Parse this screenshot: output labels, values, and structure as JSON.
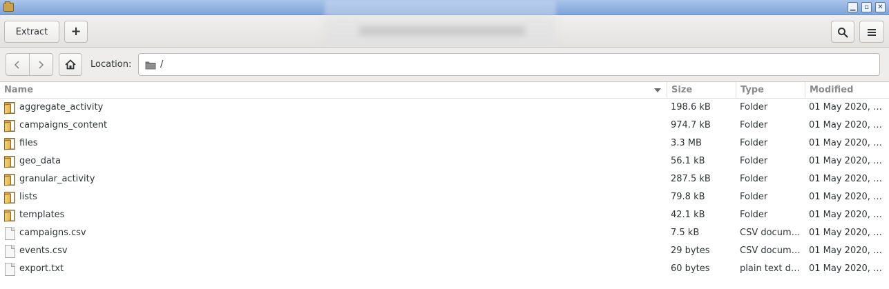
{
  "toolbar": {
    "extract_label": "Extract",
    "add_label": "+"
  },
  "location": {
    "label": "Location:",
    "path": "/"
  },
  "columns": {
    "name": "Name",
    "size": "Size",
    "type": "Type",
    "modified": "Modified"
  },
  "files": [
    {
      "icon": "folder-icon",
      "name": "aggregate_activity",
      "size": "198.6 kB",
      "type": "Folder",
      "modified": "01 May 2020, …"
    },
    {
      "icon": "folder-icon",
      "name": "campaigns_content",
      "size": "974.7 kB",
      "type": "Folder",
      "modified": "01 May 2020, …"
    },
    {
      "icon": "folder-icon",
      "name": "files",
      "size": "3.3 MB",
      "type": "Folder",
      "modified": "01 May 2020, …"
    },
    {
      "icon": "folder-icon",
      "name": "geo_data",
      "size": "56.1 kB",
      "type": "Folder",
      "modified": "01 May 2020, …"
    },
    {
      "icon": "folder-icon",
      "name": "granular_activity",
      "size": "287.5 kB",
      "type": "Folder",
      "modified": "01 May 2020, …"
    },
    {
      "icon": "folder-icon",
      "name": "lists",
      "size": "79.8 kB",
      "type": "Folder",
      "modified": "01 May 2020, …"
    },
    {
      "icon": "folder-icon",
      "name": "templates",
      "size": "42.1 kB",
      "type": "Folder",
      "modified": "01 May 2020, …"
    },
    {
      "icon": "file-icon",
      "name": "campaigns.csv",
      "size": "7.5 kB",
      "type": "CSV docum…",
      "modified": "01 May 2020, …"
    },
    {
      "icon": "file-icon",
      "name": "events.csv",
      "size": "29 bytes",
      "type": "CSV docum…",
      "modified": "01 May 2020, …"
    },
    {
      "icon": "file-icon",
      "name": "export.txt",
      "size": "60 bytes",
      "type": "plain text d…",
      "modified": "01 May 2020, …"
    }
  ]
}
